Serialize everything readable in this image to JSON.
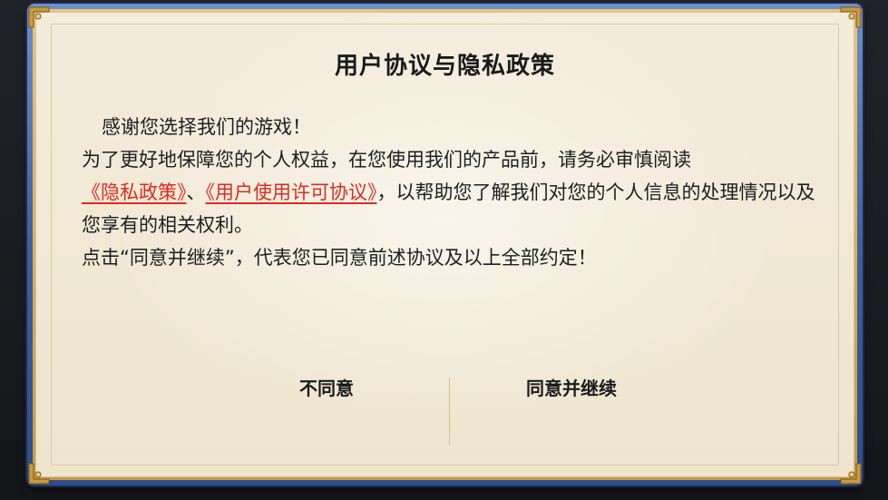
{
  "dialog": {
    "title": "用户协议与隐私政策",
    "greeting": "感谢您选择我们的游戏！",
    "paragraph_start": "为了更好地保障您的个人权益，在您使用我们的产品前，请务必审慎阅读",
    "privacy_link": "《隐私政策》",
    "separator": "、",
    "license_link": "《用户使用许可协议》",
    "paragraph_end": "，以帮助您了解我们对您的个人信息的处理情况以及您享有的相关权利。",
    "consent_note": "点击“同意并继续”，代表您已同意前述协议及以上全部约定！"
  },
  "buttons": {
    "decline_label": "不同意",
    "accept_label": "同意并继续"
  },
  "colors": {
    "link": "#e02a1f",
    "frame_blue": "#3f5fa0",
    "trim_gold": "#c79a45",
    "parchment": "#f4ecdb"
  },
  "icons": {
    "corner_ornament": "gold-corner-ornament-icon"
  }
}
